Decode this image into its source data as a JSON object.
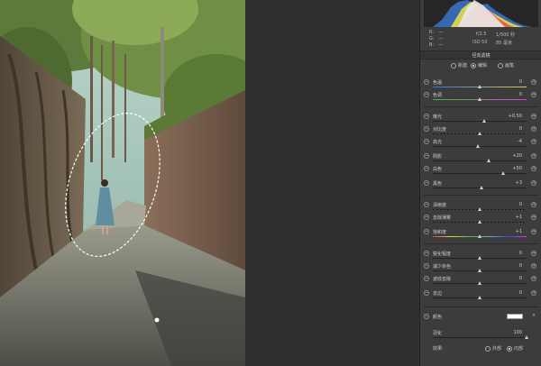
{
  "camera": {
    "r_label": "R:",
    "g_label": "G:",
    "b_label": "B:",
    "r_value": "---",
    "g_value": "---",
    "b_value": "---",
    "aperture": "f/2.5",
    "shutter": "1/500 秒",
    "iso": "ISO 50",
    "focal": "85 毫米"
  },
  "panel": {
    "title": "径向滤镜",
    "modes": [
      {
        "label": "新建",
        "selected": false
      },
      {
        "label": "编辑",
        "selected": true
      },
      {
        "label": "画笔",
        "selected": false
      }
    ]
  },
  "sliders": [
    {
      "key": "temp",
      "label": "色温",
      "value": "0",
      "pos": 0.5,
      "track": "temp"
    },
    {
      "key": "tint",
      "label": "色调",
      "value": "0",
      "pos": 0.5,
      "track": "tint"
    },
    {
      "key": "exposure",
      "label": "曝光",
      "value": "+0.50",
      "pos": 0.55,
      "track": "plain"
    },
    {
      "key": "contrast",
      "label": "对比度",
      "value": "0",
      "pos": 0.5,
      "track": "dotted"
    },
    {
      "key": "highlights",
      "label": "高光",
      "value": "-4",
      "pos": 0.48,
      "track": "plain"
    },
    {
      "key": "shadows",
      "label": "阴影",
      "value": "+20",
      "pos": 0.6,
      "track": "plain"
    },
    {
      "key": "whites",
      "label": "白色",
      "value": "+50",
      "pos": 0.75,
      "track": "plain"
    },
    {
      "key": "blacks",
      "label": "黑色",
      "value": "+3",
      "pos": 0.52,
      "track": "plain"
    },
    {
      "key": "clarity",
      "label": "清晰度",
      "value": "0",
      "pos": 0.5,
      "track": "dotted"
    },
    {
      "key": "dehaze",
      "label": "去除薄雾",
      "value": "+1",
      "pos": 0.5,
      "track": "dotted"
    },
    {
      "key": "saturation",
      "label": "饱和度",
      "value": "+1",
      "pos": 0.5,
      "track": "sat"
    },
    {
      "key": "sharpness",
      "label": "锐化程度",
      "value": "0",
      "pos": 0.5,
      "track": "plain"
    },
    {
      "key": "noise",
      "label": "减少杂色",
      "value": "0",
      "pos": 0.5,
      "track": "plain"
    },
    {
      "key": "moire",
      "label": "波纹去除",
      "value": "0",
      "pos": 0.5,
      "track": "plain"
    },
    {
      "key": "defringe",
      "label": "去边",
      "value": "0",
      "pos": 0.5,
      "track": "plain"
    }
  ],
  "color": {
    "label": "颜色",
    "swatch": "#ffffff"
  },
  "feather": {
    "label": "羽化",
    "value": "100",
    "pos": 1.0
  },
  "effect": {
    "label": "效果:",
    "options": [
      {
        "label": "外部",
        "selected": false
      },
      {
        "label": "内部",
        "selected": true
      }
    ]
  },
  "colors": {
    "panel_bg": "#3c3c3c",
    "text": "#cfcfcf",
    "canvas_gap": "#2f2f2f"
  }
}
